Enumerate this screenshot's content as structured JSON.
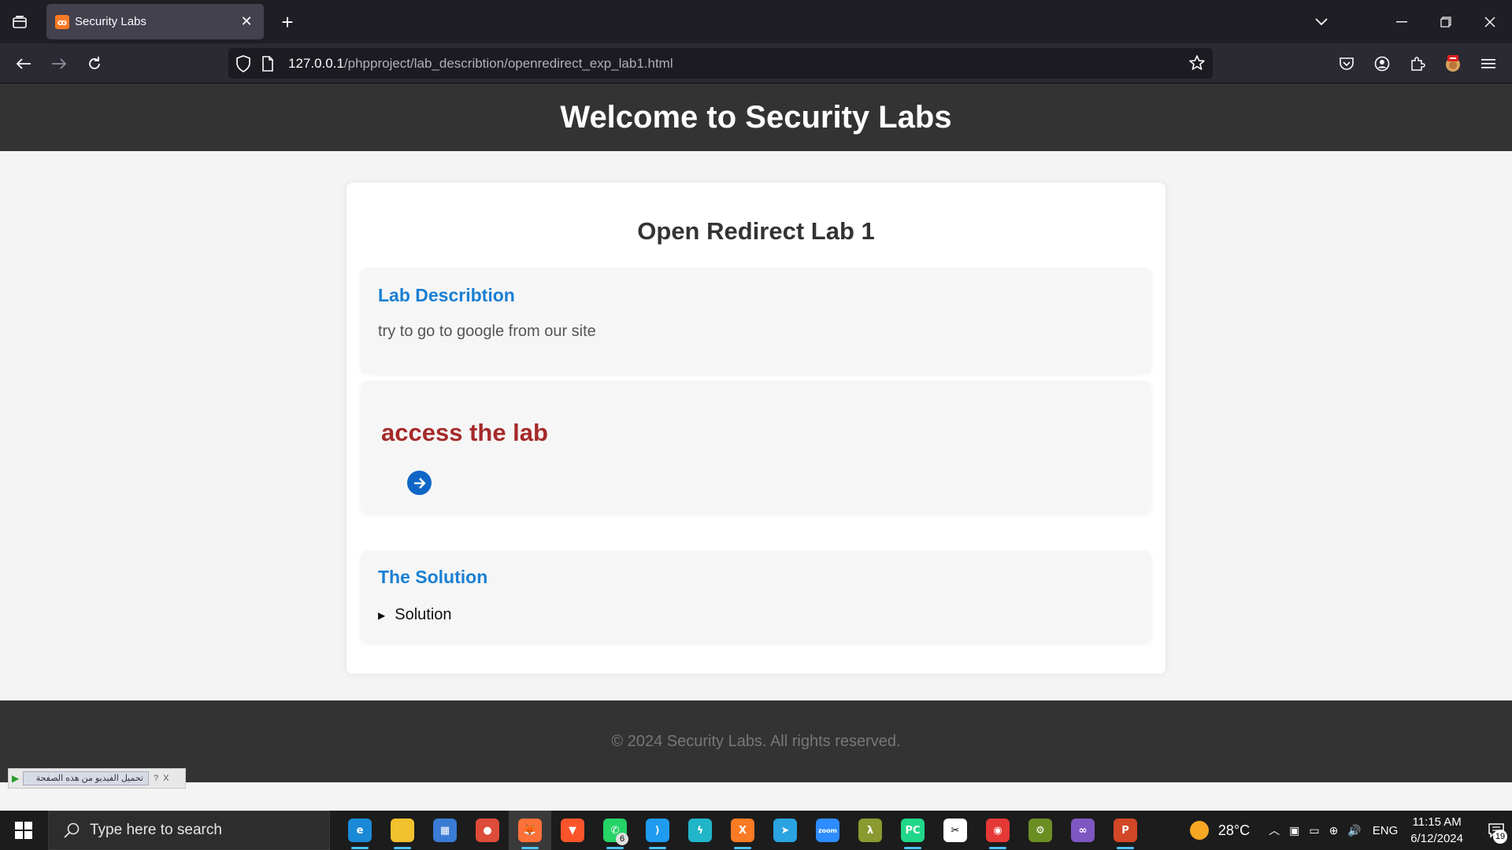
{
  "browser": {
    "tab": {
      "title": "Security Labs",
      "favicon": "xampp-icon"
    },
    "url": {
      "host": "127.0.0.1",
      "path": "/phpproject/lab_describtion/openredirect_exp_lab1.html"
    }
  },
  "site": {
    "header_title": "Welcome to Security Labs",
    "footer_text": "© 2024 Security Labs. All rights reserved."
  },
  "lab": {
    "title": "Open Redirect Lab 1",
    "description_heading": "Lab Describtion",
    "description_text": "try to go to google from our site",
    "access_heading": "access the lab",
    "solution_heading": "The Solution",
    "solution_summary": "Solution"
  },
  "extension_bar": {
    "label": "تحميل الفيديو من هذه الصفحة",
    "help": "?",
    "close": "X"
  },
  "taskbar": {
    "search_placeholder": "Type here to search",
    "apps": [
      {
        "name": "edge",
        "color": "#1b8ad6",
        "glyph": "e"
      },
      {
        "name": "file-explorer",
        "color": "#f2c12e",
        "glyph": ""
      },
      {
        "name": "store",
        "color": "#3a7bd5",
        "glyph": "▦"
      },
      {
        "name": "chrome",
        "color": "#dd4b39",
        "glyph": "●"
      },
      {
        "name": "firefox",
        "color": "#ff7139",
        "glyph": "🦊"
      },
      {
        "name": "brave",
        "color": "#fb542b",
        "glyph": "▼"
      },
      {
        "name": "whatsapp",
        "color": "#25d366",
        "glyph": "✆",
        "badge": "6"
      },
      {
        "name": "vscode",
        "color": "#1f9cf0",
        "glyph": "⟩"
      },
      {
        "name": "bolt",
        "color": "#21b5c8",
        "glyph": "ϟ"
      },
      {
        "name": "xampp",
        "color": "#fb7a24",
        "glyph": "X"
      },
      {
        "name": "telegram",
        "color": "#2aa3e0",
        "glyph": "➤"
      },
      {
        "name": "zoom",
        "color": "#2d8cff",
        "glyph": "zoom"
      },
      {
        "name": "lambda",
        "color": "#8a9a30",
        "glyph": "λ"
      },
      {
        "name": "pycharm",
        "color": "#21d789",
        "glyph": "PC"
      },
      {
        "name": "capcut",
        "color": "#ffffff",
        "glyph": "✂"
      },
      {
        "name": "recorder",
        "color": "#e53935",
        "glyph": "◉"
      },
      {
        "name": "tool",
        "color": "#6b8e23",
        "glyph": "⚙"
      },
      {
        "name": "visual-studio",
        "color": "#7e57c2",
        "glyph": "∞"
      },
      {
        "name": "powerpoint",
        "color": "#d24726",
        "glyph": "P"
      }
    ],
    "weather": "28°C",
    "language": "ENG",
    "time": "11:15 AM",
    "date": "6/12/2024",
    "notifications": "19"
  }
}
